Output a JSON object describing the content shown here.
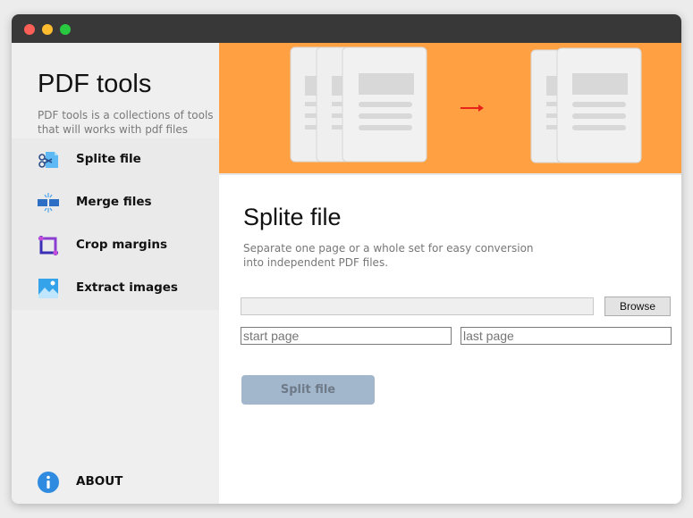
{
  "window": {
    "controls": [
      "close",
      "minimize",
      "maximize"
    ]
  },
  "sidebar": {
    "title": "PDF tools",
    "description": "PDF tools is a collections of tools that will works with pdf files",
    "items": [
      {
        "label": "Splite file",
        "icon": "scissors-icon"
      },
      {
        "label": "Merge files",
        "icon": "merge-icon"
      },
      {
        "label": "Crop margins",
        "icon": "crop-icon"
      },
      {
        "label": "Extract images",
        "icon": "image-icon"
      }
    ],
    "about": {
      "label": "ABOUT",
      "icon": "info-icon"
    }
  },
  "main": {
    "hero": {
      "background": "#ffa042",
      "arrow_color": "#e8231a"
    },
    "title": "Splite file",
    "description": "Separate one page or a whole set for easy conversion\n into independent PDF files.",
    "file_input": {
      "value": "",
      "placeholder": ""
    },
    "browse_label": "Browse",
    "start_page": {
      "placeholder": "start page",
      "value": ""
    },
    "last_page": {
      "placeholder": "last page",
      "value": ""
    },
    "split_button": {
      "label": "Split file",
      "color": "#a2b6cc"
    }
  }
}
